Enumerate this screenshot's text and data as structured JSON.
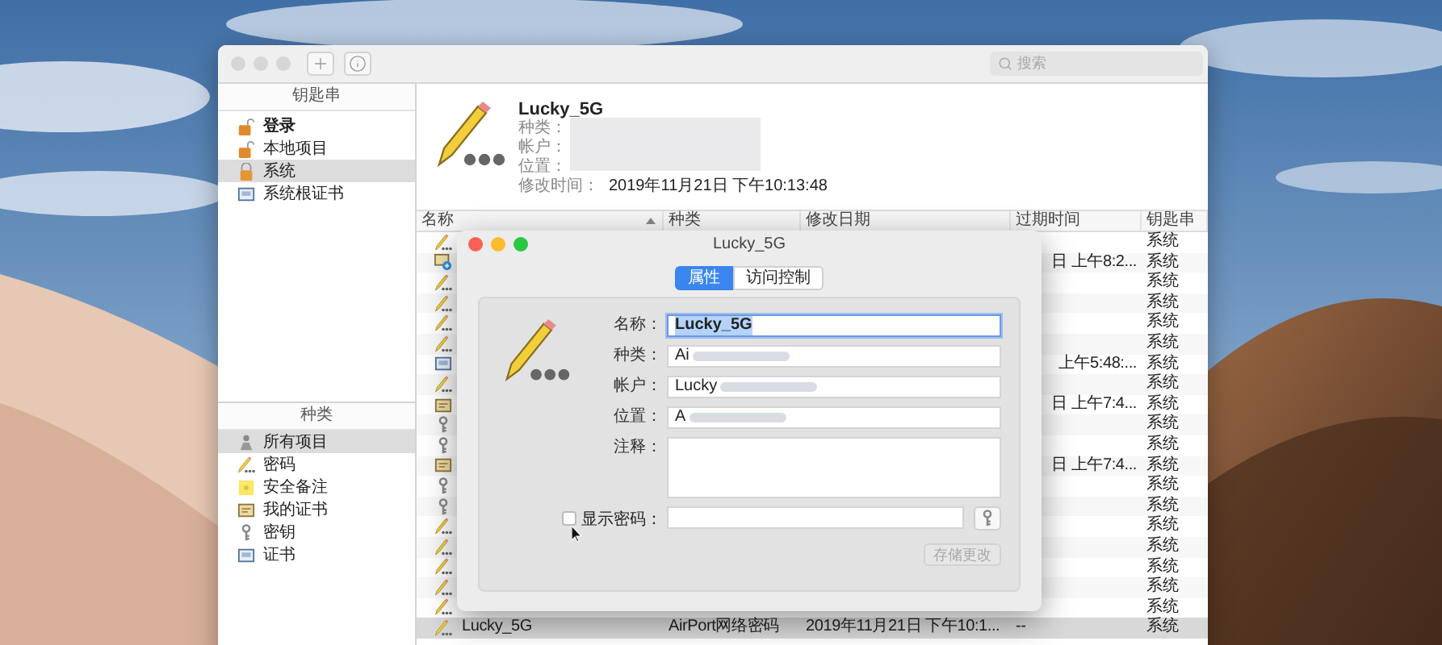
{
  "toolbar": {
    "search": {
      "placeholder": "搜索"
    }
  },
  "sidebar": {
    "keychains_title": "钥匙串",
    "keychains": [
      {
        "label": "登录",
        "kind": "unlocked",
        "default": true,
        "selected": false
      },
      {
        "label": "本地项目",
        "kind": "unlocked",
        "default": false,
        "selected": false
      },
      {
        "label": "系统",
        "kind": "locked",
        "default": false,
        "selected": true
      },
      {
        "label": "系统根证书",
        "kind": "certificate",
        "default": false,
        "selected": false
      }
    ],
    "categories_title": "种类",
    "categories": [
      {
        "label": "所有项目",
        "kind": "all",
        "selected": true
      },
      {
        "label": "密码",
        "kind": "password",
        "selected": false
      },
      {
        "label": "安全备注",
        "kind": "note",
        "selected": false
      },
      {
        "label": "我的证书",
        "kind": "identity",
        "selected": false
      },
      {
        "label": "密钥",
        "kind": "key",
        "selected": false
      },
      {
        "label": "证书",
        "kind": "certificate",
        "selected": false
      }
    ]
  },
  "detail": {
    "title": "Lucky_5G",
    "redacted": true,
    "fields": [
      {
        "label": "种类："
      },
      {
        "label": "帐户："
      },
      {
        "label": "位置："
      },
      {
        "label": "修改时间：",
        "value": "2019年11月21日 下午10:13:48"
      }
    ]
  },
  "table": {
    "columns": [
      {
        "label": "名称",
        "sorted": true
      },
      {
        "label": "种类",
        "sorted": false
      },
      {
        "label": "修改日期",
        "sorted": false
      },
      {
        "label": "过期时间",
        "sorted": false
      },
      {
        "label": "钥匙串",
        "sorted": false
      }
    ],
    "rows": [
      {
        "kind": "password",
        "keychain": "系统",
        "selected": false
      },
      {
        "kind": "certificate-new",
        "expires": "日 上午8:2...",
        "keychain": "系统",
        "selected": false
      },
      {
        "kind": "password",
        "keychain": "系统",
        "selected": false
      },
      {
        "kind": "password",
        "keychain": "系统",
        "selected": false
      },
      {
        "kind": "password",
        "keychain": "系统",
        "selected": false
      },
      {
        "kind": "password",
        "keychain": "系统",
        "selected": false
      },
      {
        "kind": "certificate",
        "expires": "上午5:48:...",
        "keychain": "系统",
        "selected": false
      },
      {
        "kind": "password",
        "keychain": "系统",
        "selected": false
      },
      {
        "kind": "identity",
        "expires": "日 上午7:4...",
        "keychain": "系统",
        "selected": false
      },
      {
        "kind": "key",
        "keychain": "系统",
        "selected": false
      },
      {
        "kind": "key",
        "keychain": "系统",
        "selected": false
      },
      {
        "kind": "identity",
        "expires": "日 上午7:4...",
        "keychain": "系统",
        "selected": false
      },
      {
        "kind": "key",
        "keychain": "系统",
        "selected": false
      },
      {
        "kind": "key",
        "keychain": "系统",
        "selected": false
      },
      {
        "kind": "password",
        "keychain": "系统",
        "selected": false
      },
      {
        "kind": "password",
        "keychain": "系统",
        "selected": false
      },
      {
        "kind": "password",
        "keychain": "系统",
        "selected": false
      },
      {
        "kind": "password",
        "keychain": "系统",
        "selected": false
      },
      {
        "kind": "password",
        "keychain": "系统",
        "selected": false
      },
      {
        "kind": "password",
        "name": "Lucky_5G",
        "type": "AirPort网络密码",
        "modified": "2019年11月21日 下午10:1...",
        "expires": "--",
        "keychain": "系统",
        "selected": true
      }
    ]
  },
  "dialog": {
    "title": "Lucky_5G",
    "tabs": [
      {
        "label": "属性",
        "selected": true
      },
      {
        "label": "访问控制",
        "selected": false
      }
    ],
    "fields": [
      {
        "label": "名称：",
        "value": "Lucky_5G",
        "kind": "line",
        "focused": true,
        "redacted": false
      },
      {
        "label": "种类：",
        "value": "Ai",
        "kind": "line",
        "focused": false,
        "redacted": true
      },
      {
        "label": "帐户：",
        "value": "Lucky",
        "kind": "line",
        "focused": false,
        "redacted": true
      },
      {
        "label": "位置：",
        "value": "A",
        "kind": "line",
        "focused": false,
        "redacted": true
      },
      {
        "label": "注释：",
        "kind": "multiline",
        "focused": false,
        "redacted": false
      }
    ],
    "show_password": {
      "label": "显示密码：",
      "checked": false
    },
    "save_button": {
      "label": "存储更改",
      "disabled": true
    }
  }
}
